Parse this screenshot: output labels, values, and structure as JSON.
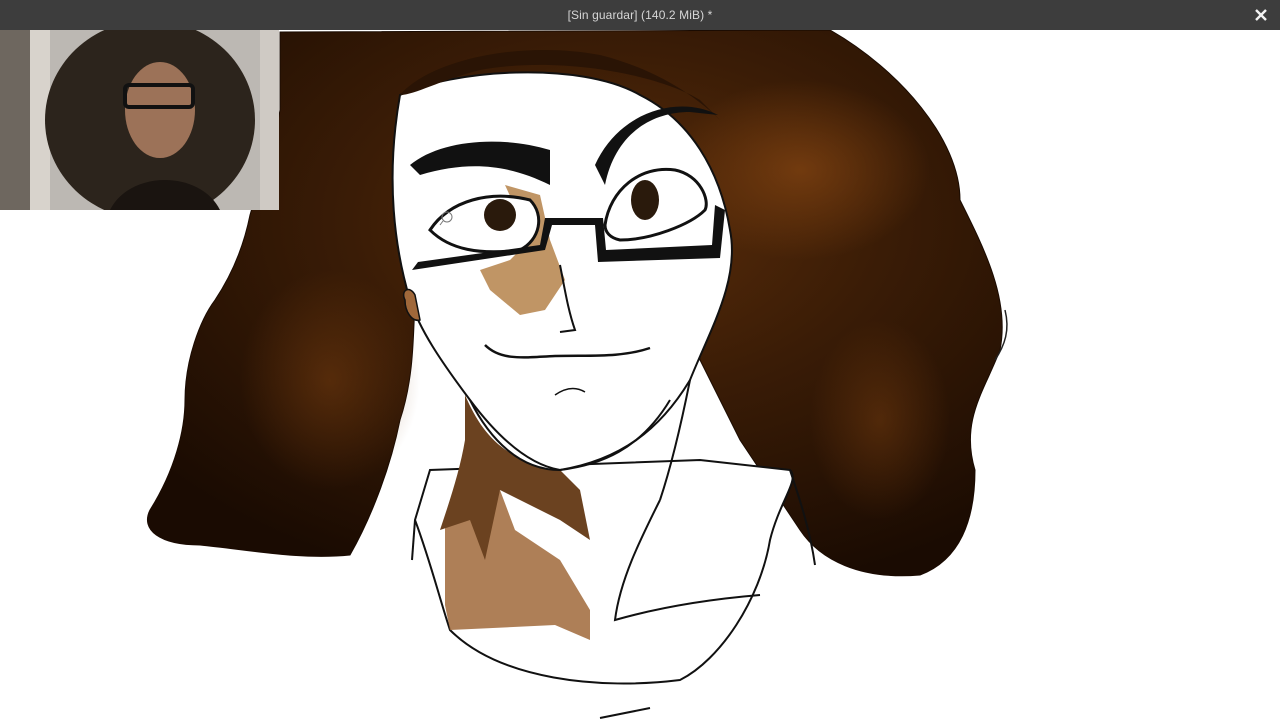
{
  "window": {
    "title": "[Sin guardar]  (140.2 MiB) *"
  },
  "icons": {
    "close": "close-icon",
    "brush_cursor": "brush-cursor-icon"
  },
  "colors": {
    "titlebar_bg": "#3d3d3d",
    "title_text": "#d6d6d6",
    "canvas_bg": "#ffffff",
    "hair_dark": "#1e0d03",
    "hair_mid": "#4a2508",
    "skin_shade": "#b07a3f",
    "line_art": "#111111"
  }
}
